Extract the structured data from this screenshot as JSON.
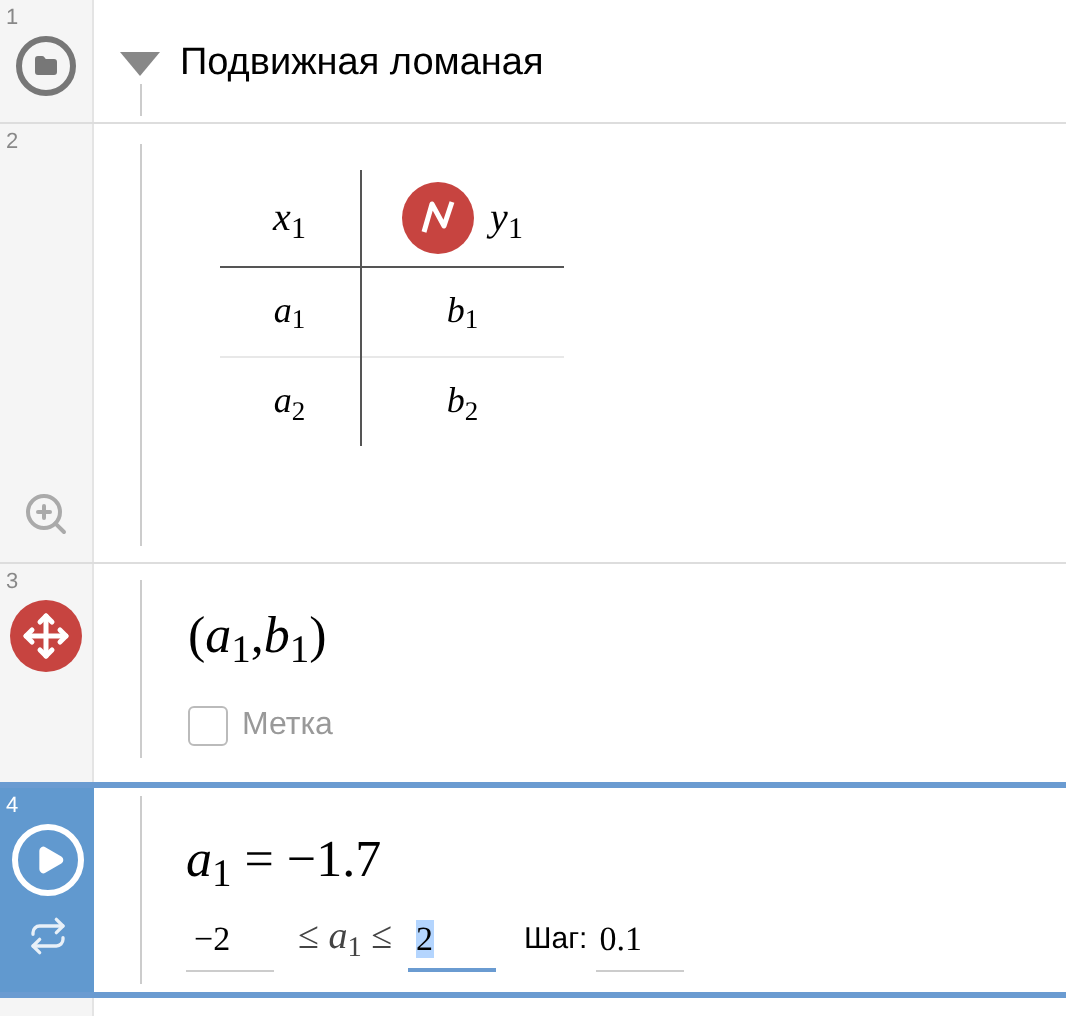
{
  "expressions": [
    {
      "number": "1",
      "kind": "folder",
      "title": "Подвижная ломаная",
      "expanded": true,
      "selected": false
    },
    {
      "number": "2",
      "kind": "table",
      "selected": false,
      "columns": [
        {
          "header": "*x*$_{1}$"
        },
        {
          "header": "*y*$_{1}$",
          "color": "#c74440"
        }
      ],
      "rows": [
        [
          "*a*$_{1}$",
          "*b*$_{1}$"
        ],
        [
          "*a*$_{2}$",
          "*b*$_{2}$"
        ]
      ]
    },
    {
      "number": "3",
      "kind": "point",
      "latex": "(*a*$_{1}$,*b*$_{1}$)",
      "color": "#c74440",
      "label_option": {
        "text": "Метка",
        "checked": false
      },
      "selected": false
    },
    {
      "number": "4",
      "kind": "slider",
      "latex": "*a*$_{1}$ = −1.7",
      "min": "−2",
      "inequality": "≤ *a*$_{1}$ ≤",
      "max": "2",
      "max_focused": true,
      "step_label": "Шаг:",
      "step": "0.1",
      "selected": true
    }
  ]
}
